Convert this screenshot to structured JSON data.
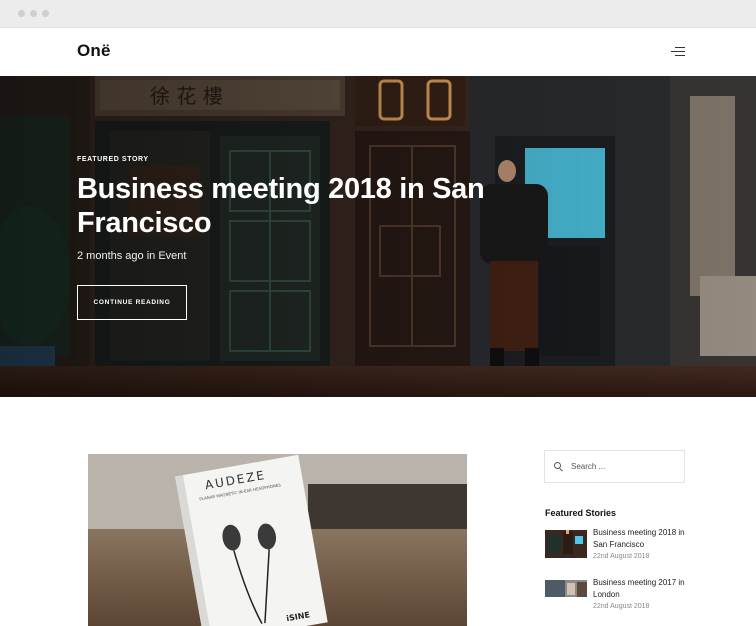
{
  "header": {
    "logo": "Onë",
    "menu_icon": "hamburger-menu-icon"
  },
  "hero": {
    "kicker": "FEATURED STORY",
    "title": "Business meeting 2018 in San Francisco",
    "meta": "2 months ago in Event",
    "button_label": "CONTINUE READING"
  },
  "sidebar": {
    "search": {
      "placeholder": "Search ...",
      "icon": "search-icon"
    },
    "featured_title": "Featured Stories",
    "stories": [
      {
        "title": "Business meeting 2018 in San Francisco",
        "date": "22nd August 2018"
      },
      {
        "title": "Business meeting 2017 in London",
        "date": "22nd August 2018"
      }
    ]
  },
  "post_image": {
    "brand": "AUDEZE",
    "subtitle": "PLANAR MAGNETIC IN-EAR HEADPHONES",
    "model": "iSINE"
  },
  "colors": {
    "accent_neon": "#e8a860",
    "window_cyan": "#4fc8e6",
    "text_dark": "#111111"
  }
}
